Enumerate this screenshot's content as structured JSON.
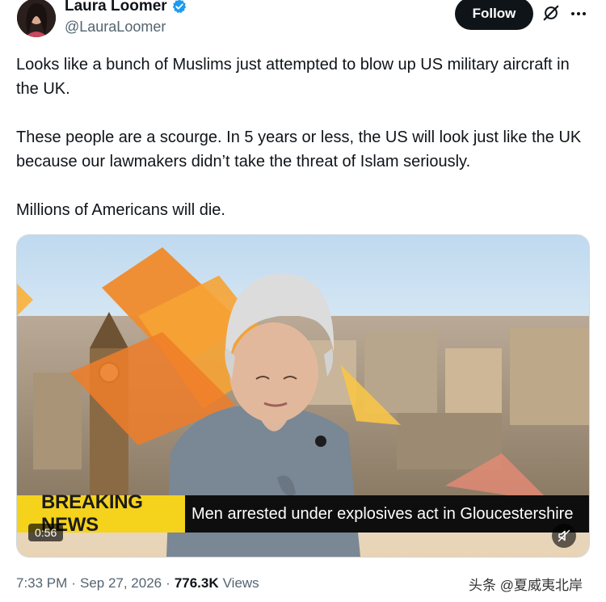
{
  "author": {
    "name": "Laura Loomer",
    "handle": "@LauraLoomer"
  },
  "actions": {
    "follow_label": "Follow"
  },
  "tweet": {
    "paragraphs": [
      "Looks like a bunch of Muslims just attempted to blow up US military aircraft in the UK.",
      "These people are a scourge. In 5 years or less, the US will look just like the UK because our lawmakers didn’t take the threat of Islam seriously.",
      "Millions of Americans will die."
    ]
  },
  "video": {
    "breaking_label": "BREAKING NEWS",
    "headline": "Men arrested under explosives act in Gloucestershire",
    "duration": "0:56"
  },
  "meta": {
    "time": "7:33 PM",
    "sep1": "·",
    "date": "Sep 27, 2026",
    "sep2": "·",
    "views_count": "776.3K",
    "views_label": "Views"
  },
  "watermark": "头条 @夏威夷北岸",
  "colors": {
    "follow_bg": "#0f1419",
    "verified": "#1d9bf0",
    "breaking_bg": "#f5d21c",
    "ticker_bg": "#0e0e0e"
  },
  "icons": [
    "verified-badge-icon",
    "grok-icon",
    "more-icon",
    "mute-icon"
  ]
}
